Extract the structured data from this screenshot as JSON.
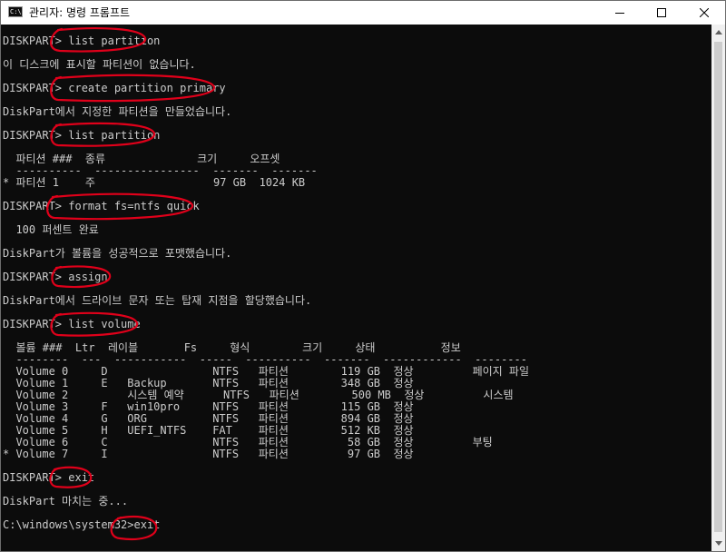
{
  "window": {
    "title": "관리자: 명령 프롬프트",
    "icon_text": "C:\\"
  },
  "terminal": {
    "lines": [
      "DISKPART> list partition",
      "",
      "이 디스크에 표시할 파티션이 없습니다.",
      "",
      "DISKPART> create partition primary",
      "",
      "DiskPart에서 지정한 파티션을 만들었습니다.",
      "",
      "DISKPART> list partition",
      "",
      "  파티션 ###  종류              크기     오프셋",
      "  ----------  ----------------  -------  -------",
      "* 파티션 1    주                  97 GB  1024 KB",
      "",
      "DISKPART> format fs=ntfs quick",
      "",
      "  100 퍼센트 완료",
      "",
      "DiskPart가 볼륨을 성공적으로 포맷했습니다.",
      "",
      "DISKPART> assign",
      "",
      "DiskPart에서 드라이브 문자 또는 탑재 지점을 할당했습니다.",
      "",
      "DISKPART> list volume",
      "",
      "  볼륨 ###  Ltr  레이블       Fs     형식        크기     상태          정보",
      "  --------  ---  -----------  -----  ----------  -------  ------------  --------",
      "  Volume 0     D                NTFS   파티션        119 GB  정상         페이지 파일",
      "  Volume 1     E   Backup       NTFS   파티션        348 GB  정상",
      "  Volume 2         시스템 예약      NTFS   파티션        500 MB  정상         시스템",
      "  Volume 3     F   win10pro     NTFS   파티션        115 GB  정상",
      "  Volume 4     G   ORG          NTFS   파티션        894 GB  정상",
      "  Volume 5     H   UEFI_NTFS    FAT    파티션        512 KB  정상",
      "  Volume 6     C                NTFS   파티션         58 GB  정상         부팅",
      "* Volume 7     I                NTFS   파티션         97 GB  정상",
      "",
      "DISKPART> exit",
      "",
      "DiskPart 마치는 중...",
      "",
      "C:\\windows\\system32>exit"
    ]
  },
  "colors": {
    "terminal_bg": "#0c0c0c",
    "terminal_text": "#cccccc",
    "annotation": "#e0001a"
  }
}
